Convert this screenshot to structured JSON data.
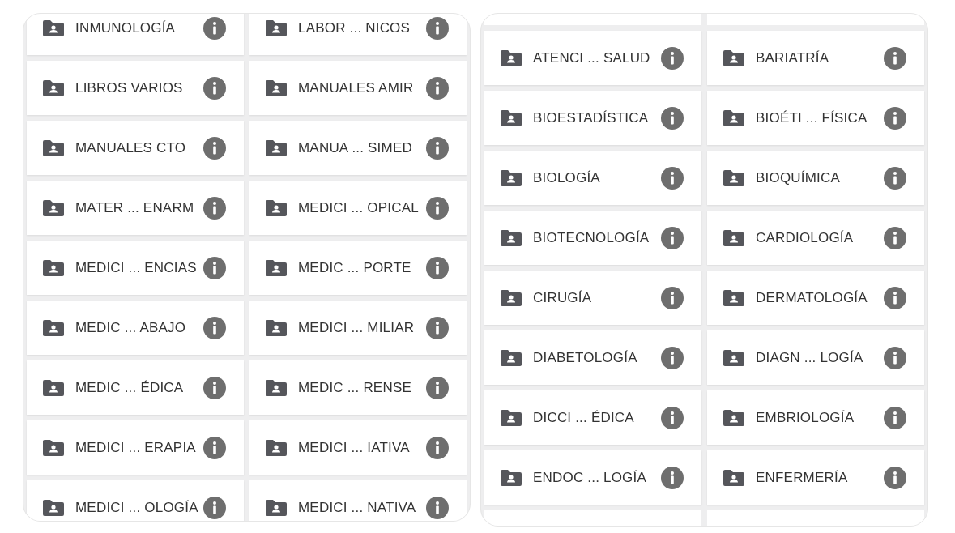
{
  "left_panel": {
    "folders": [
      {
        "label": "INMUNOLOGÍA"
      },
      {
        "label": "LABOR ... NICOS"
      },
      {
        "label": "LIBROS VARIOS"
      },
      {
        "label": "MANUALES AMIR"
      },
      {
        "label": "MANUALES CTO"
      },
      {
        "label": "MANUA ... SIMED"
      },
      {
        "label": "MATER ... ENARM"
      },
      {
        "label": "MEDICI ... OPICAL"
      },
      {
        "label": "MEDICI ... ENCIAS"
      },
      {
        "label": "MEDIC ... PORTE"
      },
      {
        "label": "MEDIC ... ABAJO"
      },
      {
        "label": "MEDICI ... MILIAR"
      },
      {
        "label": "MEDIC ... ÉDICA"
      },
      {
        "label": "MEDIC ... RENSE"
      },
      {
        "label": "MEDICI ... ERAPIA"
      },
      {
        "label": "MEDICI ... IATIVA"
      },
      {
        "label": "MEDICI ... OLOGÍA"
      },
      {
        "label": "MEDICI ... NATIVA"
      }
    ]
  },
  "right_panel": {
    "folders": [
      {
        "label": "ATENCI ... SALUD"
      },
      {
        "label": "BARIATRÍA"
      },
      {
        "label": "BIOESTADÍSTICA"
      },
      {
        "label": "BIOÉTI ... FÍSICA"
      },
      {
        "label": "BIOLOGÍA"
      },
      {
        "label": "BIOQUÍMICA"
      },
      {
        "label": "BIOTECNOLOGÍA"
      },
      {
        "label": "CARDIOLOGÍA"
      },
      {
        "label": "CIRUGÍA"
      },
      {
        "label": "DERMATOLOGÍA"
      },
      {
        "label": "DIABETOLOGÍA"
      },
      {
        "label": "DIAGN ... LOGÍA"
      },
      {
        "label": "DICCI ... ÉDICA"
      },
      {
        "label": "EMBRIOLOGÍA"
      },
      {
        "label": "ENDOC ... LOGÍA"
      },
      {
        "label": "ENFERMERÍA"
      }
    ]
  }
}
